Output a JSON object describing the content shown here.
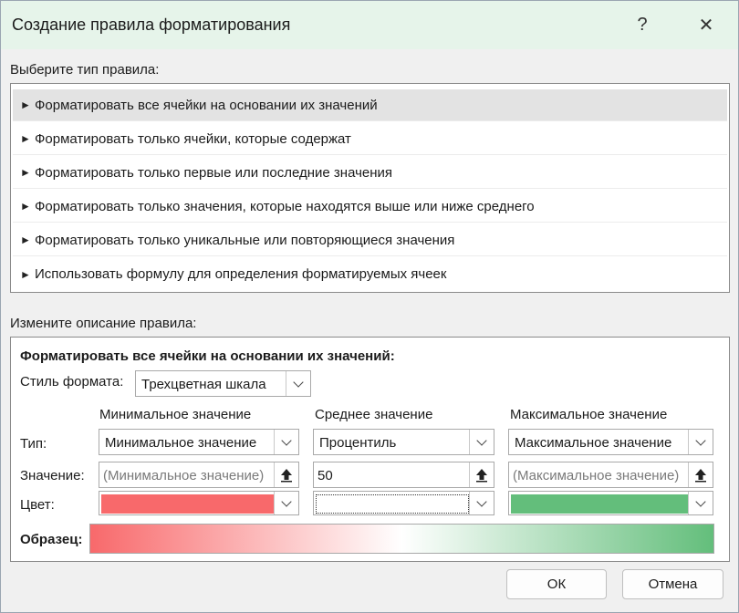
{
  "window": {
    "title": "Создание правила форматирования",
    "help_glyph": "?",
    "close_glyph": "✕"
  },
  "rule_type": {
    "label": "Выберите тип правила:",
    "items": [
      {
        "label": "Форматировать все ячейки на основании их значений",
        "selected": true
      },
      {
        "label": "Форматировать только ячейки, которые содержат",
        "selected": false
      },
      {
        "label": "Форматировать только первые или последние значения",
        "selected": false
      },
      {
        "label": "Форматировать только значения, которые находятся выше или ниже среднего",
        "selected": false
      },
      {
        "label": "Форматировать только уникальные или повторяющиеся значения",
        "selected": false
      },
      {
        "label": "Использовать формулу для определения форматируемых ячеек",
        "selected": false
      }
    ]
  },
  "description": {
    "label": "Измените описание правила:",
    "heading": "Форматировать все ячейки на основании их значений:",
    "style_label": "Стиль формата:",
    "style_value": "Трехцветная шкала",
    "columns": {
      "min_header": "Минимальное значение",
      "mid_header": "Среднее значение",
      "max_header": "Максимальное значение"
    },
    "type_label": "Тип:",
    "value_label": "Значение:",
    "color_label": "Цвет:",
    "min": {
      "type": "Минимальное значение",
      "value": "(Минимальное значение)",
      "color": "#f8696b"
    },
    "mid": {
      "type": "Процентиль",
      "value": "50",
      "color": "#ffffff"
    },
    "max": {
      "type": "Максимальное значение",
      "value": "(Максимальное значение)",
      "color": "#63be7b"
    },
    "sample_label": "Образец:"
  },
  "buttons": {
    "ok": "ОК",
    "cancel": "Отмена"
  }
}
